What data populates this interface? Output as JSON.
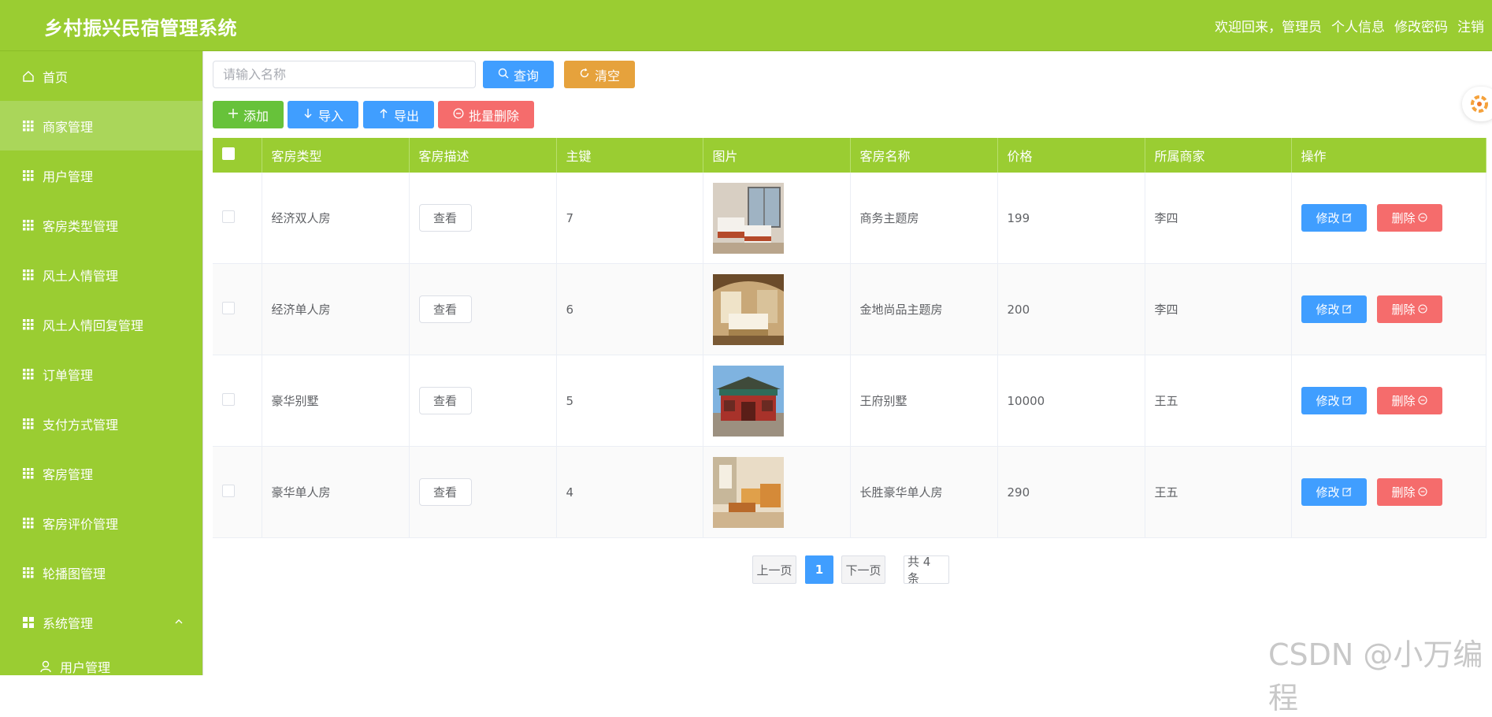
{
  "app": {
    "title": "乡村振兴民宿管理系统"
  },
  "header": {
    "welcome": "欢迎回来，管理员",
    "profile_link": "个人信息",
    "password_link": "修改密码",
    "logout_link": "注销"
  },
  "sidebar": {
    "items": [
      {
        "label": "首页",
        "icon": "home-icon"
      },
      {
        "label": "商家管理",
        "icon": "grid-icon",
        "active": true
      },
      {
        "label": "用户管理",
        "icon": "grid-icon"
      },
      {
        "label": "客房类型管理",
        "icon": "grid-icon"
      },
      {
        "label": "风土人情管理",
        "icon": "grid-icon"
      },
      {
        "label": "风土人情回复管理",
        "icon": "grid-icon"
      },
      {
        "label": "订单管理",
        "icon": "grid-icon"
      },
      {
        "label": "支付方式管理",
        "icon": "grid-icon"
      },
      {
        "label": "客房管理",
        "icon": "grid-icon"
      },
      {
        "label": "客房评价管理",
        "icon": "grid-icon"
      },
      {
        "label": "轮播图管理",
        "icon": "grid-icon"
      },
      {
        "label": "系统管理",
        "icon": "grid-icon",
        "expanded": true
      }
    ],
    "submenu": [
      {
        "label": "用户管理",
        "icon": "user-icon"
      }
    ]
  },
  "search": {
    "placeholder": "请输入名称",
    "value": ""
  },
  "toolbar": {
    "query_label": "查询",
    "clear_label": "清空",
    "add_label": "添加",
    "import_label": "导入",
    "export_label": "导出",
    "batch_delete_label": "批量删除"
  },
  "table": {
    "columns": [
      "客房类型",
      "客房描述",
      "主键",
      "图片",
      "客房名称",
      "价格",
      "所属商家",
      "操作"
    ],
    "view_label": "查看",
    "edit_label": "修改",
    "delete_label": "删除",
    "rows": [
      {
        "type": "经济双人房",
        "id": "7",
        "name": "商务主题房",
        "price": "199",
        "merchant": "李四",
        "image": "hotel-twin-room"
      },
      {
        "type": "经济单人房",
        "id": "6",
        "name": "金地尚品主题房",
        "price": "200",
        "merchant": "李四",
        "image": "hotel-single-room"
      },
      {
        "type": "豪华别墅",
        "id": "5",
        "name": "王府别墅",
        "price": "10000",
        "merchant": "王五",
        "image": "chinese-palace-gate"
      },
      {
        "type": "豪华单人房",
        "id": "4",
        "name": "长胜豪华单人房",
        "price": "290",
        "merchant": "王五",
        "image": "hotel-suite-room"
      }
    ]
  },
  "pagination": {
    "prev_label": "上一页",
    "current_page": "1",
    "next_label": "下一页",
    "total_label": "共 4 条"
  },
  "watermark": "CSDN @小万编程",
  "colors": {
    "brand_green": "#9acd32",
    "primary_blue": "#409eff",
    "success_green": "#67c23a",
    "warning_orange": "#e6a23c",
    "danger_red": "#f56c6c"
  }
}
